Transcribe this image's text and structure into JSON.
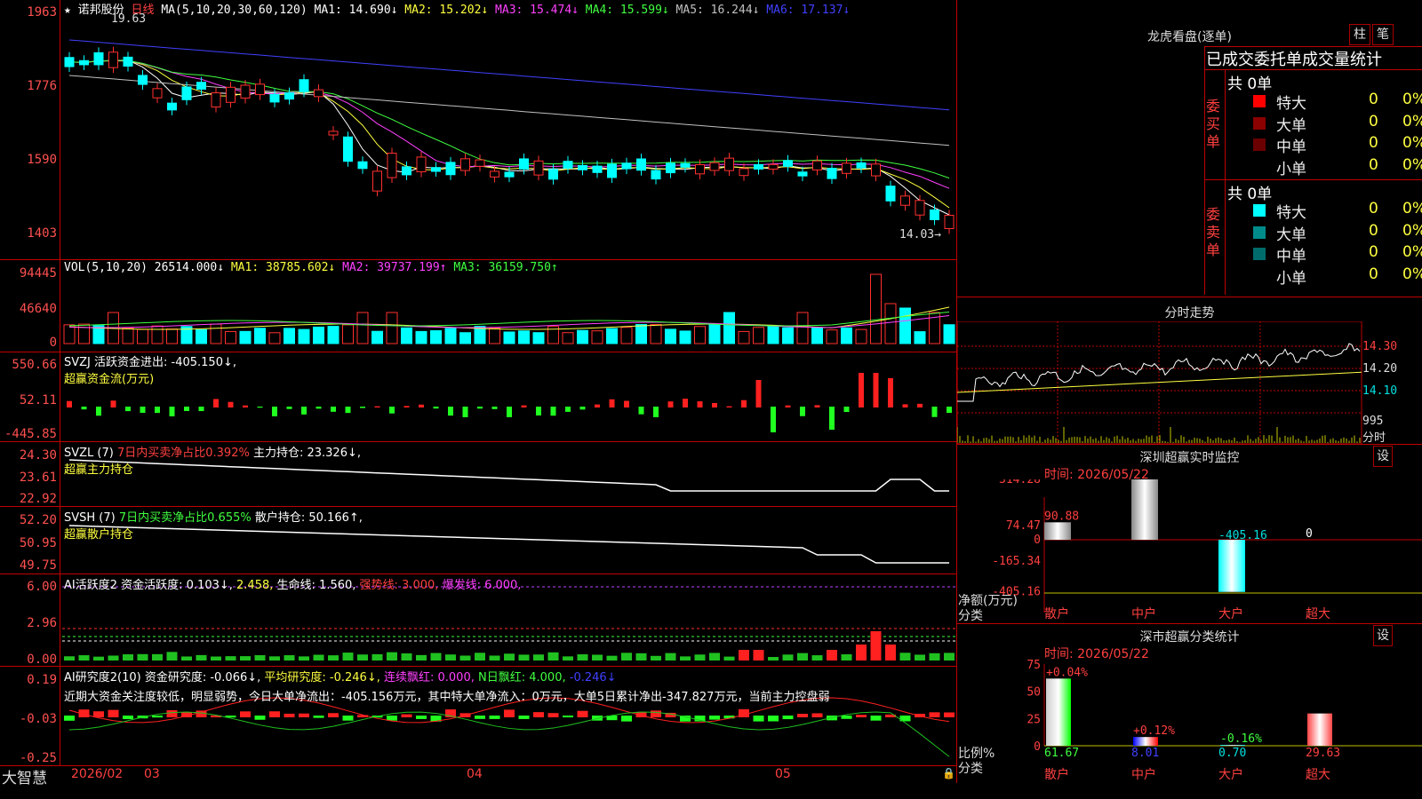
{
  "stock": {
    "star": "★",
    "name": "诺邦股份",
    "period": "日线",
    "ma_header": "MA(5,10,20,30,60,120)",
    "ma": [
      {
        "label": "MA1: 14.690↓",
        "color": "#ffffff"
      },
      {
        "label": "MA2: 15.202↓",
        "color": "#ffff40"
      },
      {
        "label": "MA3: 15.474↓",
        "color": "#ff40ff"
      },
      {
        "label": "MA4: 15.599↓",
        "color": "#40ff40"
      },
      {
        "label": "MA5: 16.244↓",
        "color": "#c0c0c0"
      },
      {
        "label": "MA6: 17.137↓",
        "color": "#4040ff"
      }
    ],
    "high_mark": "19.63",
    "low_mark": "14.03→",
    "yaxis": [
      "1963",
      "1776",
      "1590",
      "1403"
    ]
  },
  "vol": {
    "header": "VOL(5,10,20)",
    "value": "26514.000↓",
    "ma": [
      {
        "label": "MA1: 38785.602↓",
        "color": "#ffff40"
      },
      {
        "label": "MA2: 39737.199↑",
        "color": "#ff40ff"
      },
      {
        "label": "MA3: 36159.750↑",
        "color": "#40ff40"
      }
    ],
    "yaxis": [
      "94445",
      "46640",
      "0"
    ]
  },
  "svzj": {
    "header": "SVZJ  活跃资金进出: -405.150↓,",
    "sub": "超赢资金流(万元)",
    "yaxis": [
      "550.66",
      "52.11",
      "-445.85"
    ]
  },
  "svzl": {
    "header": "SVZL (7)",
    "ratio": "7日内买卖净占比0.392%",
    "hold": "主力持仓: 23.326↓,",
    "sub": "超赢主力持仓",
    "yaxis": [
      "24.30",
      "23.61",
      "22.92"
    ]
  },
  "svsh": {
    "header": "SVSH (7)",
    "ratio": "7日内买卖净占比0.655%",
    "hold": "散户持仓: 50.166↑,",
    "sub": "超赢散户持仓",
    "yaxis": [
      "52.20",
      "50.95",
      "49.75"
    ]
  },
  "ai_active": {
    "header": "AI活跃度2 资金活跃度: 0.103↓,",
    "v2": "2.458,",
    "life": "生命线: 1.560,",
    "strong": "强势线: 3.000,",
    "burst": "爆发线: 6.000,",
    "yaxis": [
      "6.00",
      "2.96",
      "0.00"
    ]
  },
  "ai_research": {
    "header": "AI研究度2(10) 资金研究度: -0.066↓,",
    "avg": "平均研究度: -0.246↓,",
    "lianxu": "连续飘红: 0.000,",
    "nday": "N日飘红: 4.000,",
    "last": "-0.246↓",
    "comment": "近期大资金关注度较低，明显弱势，今日大单净流出：-405.156万元，其中特大单净流入：0万元，大单5日累计净出-347.827万元，当前主力控盘弱",
    "yaxis": [
      "0.19",
      "-0.03",
      "-0.25"
    ]
  },
  "xaxis": {
    "brand": "大智慧",
    "labels": [
      "2026/02",
      "03",
      "04",
      "05"
    ]
  },
  "right": {
    "dragon_title": "龙虎看盘(逐单)",
    "btn_bar": "柱",
    "btn_pen": "笔",
    "stat_title": "已成交委托单成交量统计",
    "buy_side": "委买单",
    "sell_side": "委卖单",
    "buy_total": "共 0单",
    "sell_total": "共 0单",
    "buy_rows": [
      {
        "label": "特大",
        "count": "0",
        "pct": "0%",
        "color": "#ff0000"
      },
      {
        "label": "大单",
        "count": "0",
        "pct": "0%",
        "color": "#8b0000"
      },
      {
        "label": "中单",
        "count": "0",
        "pct": "0%",
        "color": "#6b0000"
      },
      {
        "label": "小单",
        "count": "0",
        "pct": "0%",
        "color": "#000000"
      }
    ],
    "sell_rows": [
      {
        "label": "特大",
        "count": "0",
        "pct": "0%",
        "color": "#00ffff"
      },
      {
        "label": "大单",
        "count": "0",
        "pct": "0%",
        "color": "#008b8b"
      },
      {
        "label": "中单",
        "count": "0",
        "pct": "0%",
        "color": "#006b6b"
      },
      {
        "label": "小单",
        "count": "0",
        "pct": "0%",
        "color": "#000000"
      }
    ],
    "minute_title": "分时走势",
    "minute_yaxis": [
      "14.30",
      "14.20",
      "14.10"
    ],
    "minute_vol": "995",
    "minute_vol_unit": "分时",
    "sz_title": "深圳超赢实时监控",
    "sz_btn": "设",
    "sz_time": "时间: 2026/05/22",
    "sz_yaxis": [
      "314.28",
      "74.47",
      "0",
      "-165.34",
      "-405.16"
    ],
    "sz_unit1": "净额(万元)",
    "sz_unit2": "分类",
    "sz_values": [
      "90.88",
      "314.28",
      "-405.16",
      "0"
    ],
    "cats": [
      "散户",
      "中户",
      "大户",
      "超大"
    ],
    "cls_title": "深市超赢分类统计",
    "cls_btn": "设",
    "cls_time": "时间: 2026/05/22",
    "cls_yaxis": [
      "75",
      "50",
      "25",
      "0"
    ],
    "cls_unit1": "比例%",
    "cls_unit2": "分类",
    "cls_changes": [
      "+0.04%",
      "+0.12%",
      "-0.16%",
      ""
    ],
    "cls_values": [
      "61.67",
      "8.01",
      "0.70",
      "29.63"
    ]
  }
}
